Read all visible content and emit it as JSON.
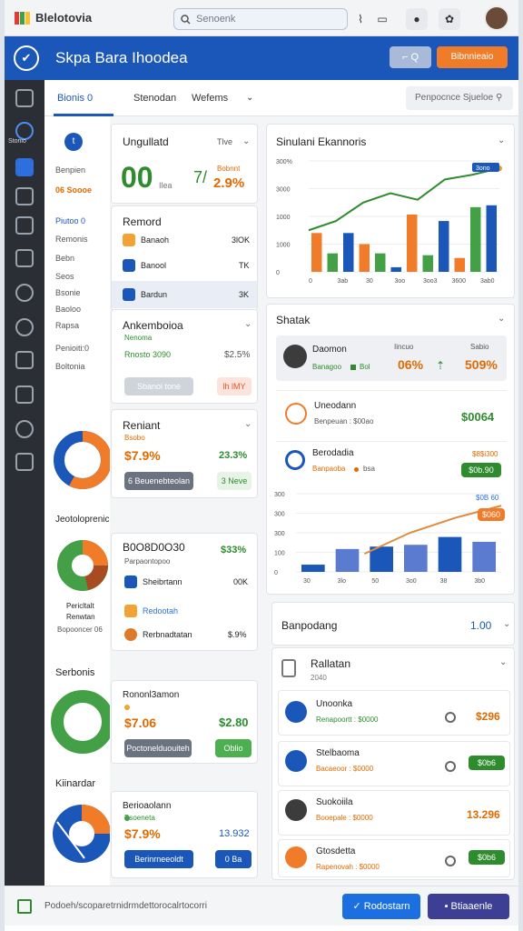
{
  "app": {
    "name": "Blelotovia",
    "header_title": "Skpa Bara Ihoodea"
  },
  "search": {
    "placeholder": "Senoenk"
  },
  "header": {
    "btn1": "⌐ Q",
    "btn2": "Bibnnieaio"
  },
  "tabs": [
    {
      "label": "Bionis 0"
    },
    {
      "label": "Stenodan"
    },
    {
      "label": "Wefems"
    }
  ],
  "tabs_search": "Penpocnce Sjueloe",
  "left": {
    "items": [
      "Benpien",
      "Piutoo 0",
      "Remonis",
      "Bebn",
      "Seos",
      "Bsonie",
      "Baoloo",
      "Rapsa",
      "Penioiti:0",
      "Boltonia"
    ],
    "highlight": "06 Soooe",
    "sec1": "Jeotoloprenicmantan",
    "sec1_sub1": "Pericltalt",
    "sec1_sub2": "Renwtan",
    "sec1_sub3": "Bopooncer 06",
    "sec2": "Serbonis",
    "sec3": "Kiinardar"
  },
  "mid": {
    "c1": {
      "title": "Ungullatd",
      "side": "Tlve",
      "big": "00",
      "sub": "Ilea",
      "pct": "2.9%",
      "pct_top": "Bobnnt",
      "mini": "7/"
    },
    "c2": {
      "title": "Remord",
      "rows": [
        {
          "name": "Banaoh",
          "val": "3lOK"
        },
        {
          "name": "Banool",
          "val": "TK"
        },
        {
          "name": "Bardun",
          "val": "3K"
        }
      ]
    },
    "c3": {
      "title": "Ankemboioa",
      "sub": "Nenoma",
      "line": "Rnosto 3090",
      "pct": "$2.5%",
      "btn1": "Sbanoi tone",
      "btn2": "lh lMY"
    },
    "c4": {
      "title": "Reniant",
      "sub": "Bsobo",
      "v1": "$7.9%",
      "v2": "23.3%",
      "btn1": "6 Beuenebteolan",
      "btn2": "3 Neve"
    },
    "c5": {
      "title": "B0O8D0O30",
      "sub": "Parpaontopoo",
      "pct": "$33%",
      "rows": [
        {
          "name": "Sheibrtann",
          "val": "00K"
        },
        {
          "name": "Redootah",
          "val": ""
        },
        {
          "name": "Rerbnadtatan",
          "val": "$.9%"
        }
      ]
    },
    "c6": {
      "title": "Rononl3amon",
      "v1": "$7.06",
      "v2": "$2.80",
      "btn1": "Poctonelduouiteh",
      "btn2": "Oblio"
    },
    "c7": {
      "title": "Berioaolann",
      "sub": "Bsoeneta",
      "v1": "$7.9%",
      "v2": "13.932",
      "btn1": "Berinrneeoldt",
      "btn2": "0 Ba"
    }
  },
  "right": {
    "chart1_title": "Sinulani Ekannoris",
    "shortlist_title": "Shatak",
    "p1": {
      "name": "Daomon",
      "sub": "Banagoo",
      "tag": "Bol",
      "c1": "Iincuo",
      "c2": "Sabio",
      "v1": "06%",
      "v2": "509%",
      "ct": "3OO"
    },
    "p2": {
      "name": "Uneodann",
      "sub": "Benpeuan : $00ao",
      "val": "$0064"
    },
    "p3": {
      "name": "Berodadia",
      "sub": "Banpaoba",
      "tag": "bsa",
      "top": "$8$i300",
      "btn": "$0b.90"
    },
    "chart2_tag1": "$0B 60",
    "chart2_tag2": "$060",
    "bar_title": "Banpodang",
    "bar_val": "1.00",
    "list_title": "Rallatan",
    "list_sub": "2040",
    "list": [
      {
        "name": "Unoonka",
        "sub": "Renapoortt : $0000",
        "val": "$296",
        "type": "text"
      },
      {
        "name": "Stelbaoma",
        "sub": "Bacaeoor : $0000",
        "val": "$0b6",
        "type": "btn"
      },
      {
        "name": "Suokoiila",
        "sub": "Booepale : $0000",
        "val": "13.296",
        "type": "text"
      },
      {
        "name": "Gtosdetta",
        "sub": "Rapenovah : $0000",
        "val": "$0b6",
        "type": "btn"
      }
    ]
  },
  "footer": {
    "text": "Podoeh/scoparetrnidrmdettorocalrtocorri",
    "btn1": "Rodostarn",
    "btn2": "Btiaaenle"
  },
  "chart_data": [
    {
      "type": "bar",
      "title": "Sinulani Ekannoris",
      "categories": [
        "0",
        "3ab",
        "30",
        "3oo",
        "3oo3",
        "3600",
        "3ab0",
        "",
        "",
        "",
        "",
        ""
      ],
      "series": [
        {
          "name": "",
          "values": [
            42,
            20,
            42,
            30,
            20,
            5,
            62,
            18,
            55,
            15,
            70,
            72
          ]
        },
        {
          "name": "",
          "values": [
            45,
            55,
            75,
            85,
            78,
            100,
            105,
            112
          ]
        }
      ],
      "yticks": [
        "300%",
        "3000",
        "1000",
        "1000",
        "0"
      ],
      "tag": "3ono",
      "ylim": [
        0,
        120
      ]
    },
    {
      "type": "bar",
      "categories": [
        "30",
        "3lo",
        "50",
        "3o0",
        "38",
        "3b0"
      ],
      "yticks": [
        "300",
        "300",
        "300",
        "100",
        "0"
      ],
      "series": [
        {
          "name": "",
          "values": [
            12,
            38,
            42,
            45,
            58,
            50
          ]
        },
        {
          "name": "",
          "values": [
            30,
            65,
            90,
            110
          ]
        }
      ],
      "ylim": [
        0,
        130
      ]
    }
  ]
}
